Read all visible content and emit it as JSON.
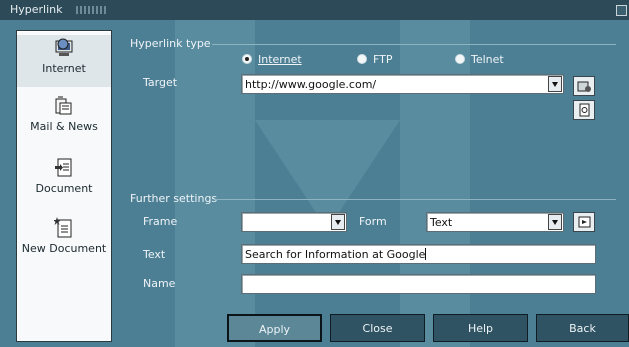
{
  "window": {
    "title": "Hyperlink"
  },
  "sidebar": {
    "items": [
      {
        "label": "Internet",
        "icon": "internet-globe-icon"
      },
      {
        "label": "Mail & News",
        "icon": "mail-news-icon"
      },
      {
        "label": "Document",
        "icon": "document-icon"
      },
      {
        "label": "New Document",
        "icon": "new-document-icon"
      }
    ]
  },
  "hyperlink_type": {
    "heading": "Hyperlink type",
    "options": [
      {
        "label": "Internet",
        "selected": true
      },
      {
        "label": "FTP",
        "selected": false
      },
      {
        "label": "Telnet",
        "selected": false
      }
    ]
  },
  "target": {
    "label": "Target",
    "value": "http://www.google.com/"
  },
  "further_settings": {
    "heading": "Further settings",
    "frame_label": "Frame",
    "frame_value": "",
    "form_label": "Form",
    "form_value": "Text",
    "text_label": "Text",
    "text_value": "Search for Information at Google",
    "name_label": "Name",
    "name_value": ""
  },
  "buttons": {
    "apply": "Apply",
    "close": "Close",
    "help": "Help",
    "back": "Back"
  },
  "colors": {
    "background": "#4d7f94",
    "titlebar": "#2c4a57",
    "button": "#2f5362"
  }
}
